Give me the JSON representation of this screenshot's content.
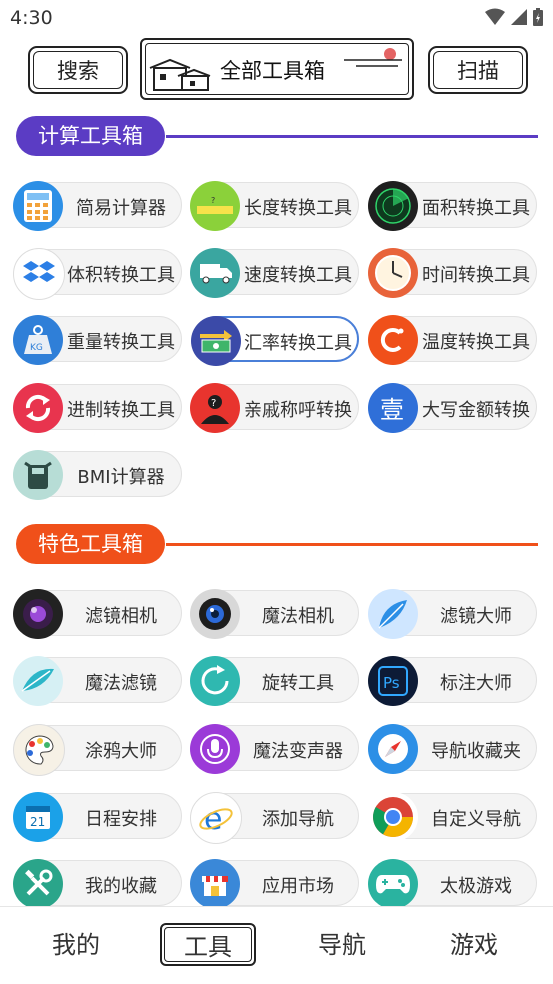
{
  "status_bar": {
    "time": "4:30",
    "icons": [
      "wifi-icon",
      "signal-icon",
      "battery-icon"
    ]
  },
  "header": {
    "search_label": "搜索",
    "title": "全部工具箱",
    "scan_label": "扫描"
  },
  "sections": [
    {
      "title": "计算工具箱",
      "color": "#5b3cc4",
      "tools": [
        {
          "label": "简易计算器",
          "icon": "calculator-icon"
        },
        {
          "label": "长度转换工具",
          "icon": "ruler-icon"
        },
        {
          "label": "面积转换工具",
          "icon": "radar-icon"
        },
        {
          "label": "体积转换工具",
          "icon": "box-icon"
        },
        {
          "label": "速度转换工具",
          "icon": "truck-icon"
        },
        {
          "label": "时间转换工具",
          "icon": "clock-icon"
        },
        {
          "label": "重量转换工具",
          "icon": "weight-icon"
        },
        {
          "label": "汇率转换工具",
          "icon": "money-icon"
        },
        {
          "label": "温度转换工具",
          "icon": "temperature-icon"
        },
        {
          "label": "进制转换工具",
          "icon": "refresh-icon"
        },
        {
          "label": "亲戚称呼转换",
          "icon": "person-question-icon"
        },
        {
          "label": "大写金额转换",
          "icon": "chinese-numeral-icon"
        },
        {
          "label": "BMI计算器",
          "icon": "scale-icon"
        }
      ]
    },
    {
      "title": "特色工具箱",
      "color": "#f0501a",
      "tools": [
        {
          "label": "滤镜相机",
          "icon": "camera-lens-icon"
        },
        {
          "label": "魔法相机",
          "icon": "camera-icon"
        },
        {
          "label": "滤镜大师",
          "icon": "feather-blue-icon"
        },
        {
          "label": "魔法滤镜",
          "icon": "feather-teal-icon"
        },
        {
          "label": "旋转工具",
          "icon": "rotate-icon"
        },
        {
          "label": "标注大师",
          "icon": "photoshop-icon"
        },
        {
          "label": "涂鸦大师",
          "icon": "palette-icon"
        },
        {
          "label": "魔法变声器",
          "icon": "microphone-icon"
        },
        {
          "label": "导航收藏夹",
          "icon": "compass-icon"
        },
        {
          "label": "日程安排",
          "icon": "calendar-icon"
        },
        {
          "label": "添加导航",
          "icon": "ie-browser-icon"
        },
        {
          "label": "自定义导航",
          "icon": "chrome-icon"
        },
        {
          "label": "我的收藏",
          "icon": "tools-icon"
        },
        {
          "label": "应用市场",
          "icon": "store-icon"
        },
        {
          "label": "太极游戏",
          "icon": "gamepad-icon"
        }
      ]
    }
  ],
  "selected_tool": "汇率转换工具",
  "bottom_nav": [
    {
      "label": "我的",
      "active": false
    },
    {
      "label": "工具",
      "active": true
    },
    {
      "label": "导航",
      "active": false
    },
    {
      "label": "游戏",
      "active": false
    }
  ]
}
